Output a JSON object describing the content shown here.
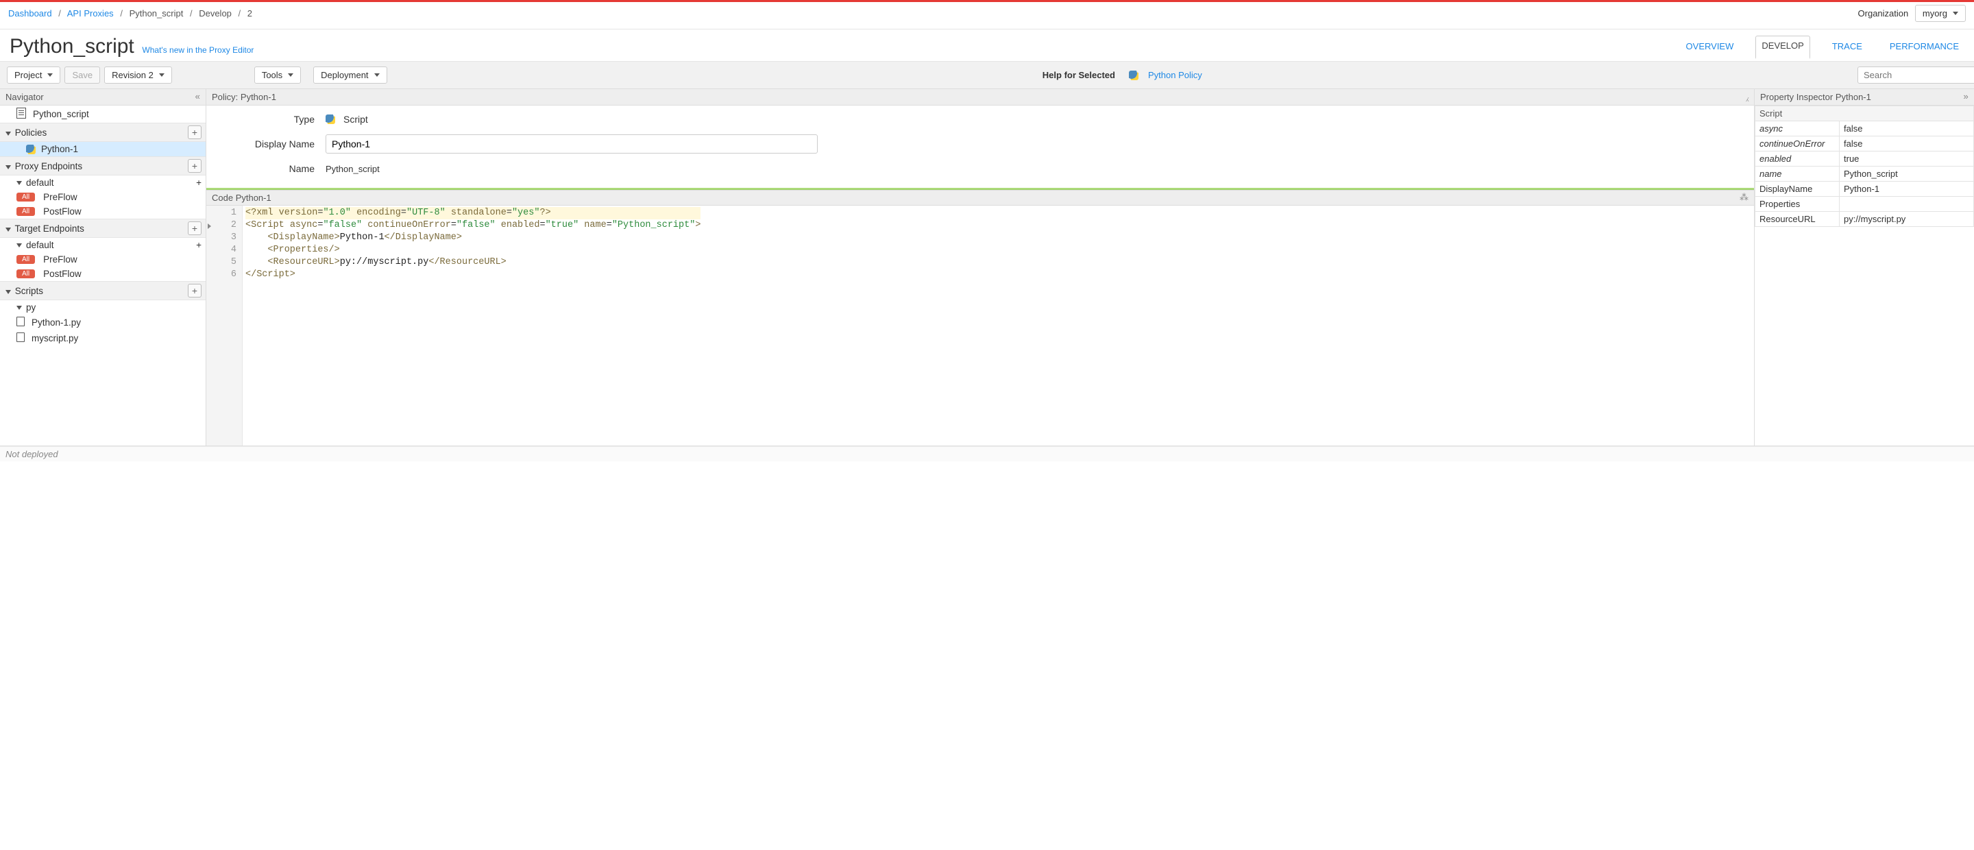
{
  "breadcrumb": {
    "items": [
      {
        "label": "Dashboard",
        "link": true
      },
      {
        "label": "API Proxies",
        "link": true
      },
      {
        "label": "Python_script",
        "link": false
      },
      {
        "label": "Develop",
        "link": false
      },
      {
        "label": "2",
        "link": false
      }
    ]
  },
  "organization": {
    "label": "Organization",
    "value": "myorg"
  },
  "page": {
    "title": "Python_script",
    "whatsnew": "What's new in the Proxy Editor"
  },
  "tabs": {
    "overview": "OVERVIEW",
    "develop": "DEVELOP",
    "trace": "TRACE",
    "performance": "PERFORMANCE",
    "active": "develop"
  },
  "toolbar": {
    "project": "Project",
    "save": "Save",
    "revision": "Revision 2",
    "tools": "Tools",
    "deployment": "Deployment",
    "help_label": "Help for Selected",
    "policy_link": "Python Policy",
    "search_placeholder": "Search"
  },
  "navigator": {
    "title": "Navigator",
    "root": "Python_script",
    "policies": {
      "label": "Policies",
      "items": [
        {
          "label": "Python-1",
          "selected": true
        }
      ]
    },
    "proxy_endpoints": {
      "label": "Proxy Endpoints",
      "groups": [
        {
          "label": "default",
          "flows": [
            {
              "badge": "All",
              "label": "PreFlow"
            },
            {
              "badge": "All",
              "label": "PostFlow"
            }
          ]
        }
      ]
    },
    "target_endpoints": {
      "label": "Target Endpoints",
      "groups": [
        {
          "label": "default",
          "flows": [
            {
              "badge": "All",
              "label": "PreFlow"
            },
            {
              "badge": "All",
              "label": "PostFlow"
            }
          ]
        }
      ]
    },
    "scripts": {
      "label": "Scripts",
      "groups": [
        {
          "label": "py",
          "files": [
            "Python-1.py",
            "myscript.py"
          ]
        }
      ]
    }
  },
  "policy_panel": {
    "header": "Policy: Python-1",
    "type_label": "Type",
    "type_value": "Script",
    "display_name_label": "Display Name",
    "display_name_value": "Python-1",
    "name_label": "Name",
    "name_value": "Python_script",
    "code_header": "Code   Python-1"
  },
  "code": {
    "lines": [
      {
        "n": 1,
        "html": "<span class='pi'>&lt;?xml</span> <span class='a'>version</span>=<span class='s'>\"1.0\"</span> <span class='a'>encoding</span>=<span class='s'>\"UTF-8\"</span> <span class='a'>standalone</span>=<span class='s'>\"yes\"</span><span class='pi'>?&gt;</span>",
        "highlight": true
      },
      {
        "n": 2,
        "fold": true,
        "html": "<span class='t'>&lt;Script</span> <span class='a'>async</span>=<span class='s'>\"false\"</span> <span class='a'>continueOnError</span>=<span class='s'>\"false\"</span> <span class='a'>enabled</span>=<span class='s'>\"true\"</span> <span class='a'>name</span>=<span class='s'>\"Python_script\"</span><span class='t'>&gt;</span>"
      },
      {
        "n": 3,
        "html": "    <span class='t'>&lt;DisplayName&gt;</span><span class='tx'>Python-1</span><span class='t'>&lt;/DisplayName&gt;</span>"
      },
      {
        "n": 4,
        "html": "    <span class='t'>&lt;Properties/&gt;</span>"
      },
      {
        "n": 5,
        "html": "    <span class='t'>&lt;ResourceURL&gt;</span><span class='tx'>py://myscript.py</span><span class='t'>&lt;/ResourceURL&gt;</span>"
      },
      {
        "n": 6,
        "html": "<span class='t'>&lt;/Script&gt;</span>"
      }
    ]
  },
  "inspector": {
    "title": "Property Inspector  Python-1",
    "section": "Script",
    "rows": [
      {
        "k": "async",
        "v": "false",
        "italic": true
      },
      {
        "k": "continueOnError",
        "v": "false",
        "italic": true
      },
      {
        "k": "enabled",
        "v": "true",
        "italic": true
      },
      {
        "k": "name",
        "v": "Python_script",
        "italic": true
      },
      {
        "k": "DisplayName",
        "v": "Python-1"
      },
      {
        "k": "Properties",
        "v": ""
      },
      {
        "k": "ResourceURL",
        "v": "py://myscript.py"
      }
    ]
  },
  "status": {
    "text": "Not deployed"
  }
}
